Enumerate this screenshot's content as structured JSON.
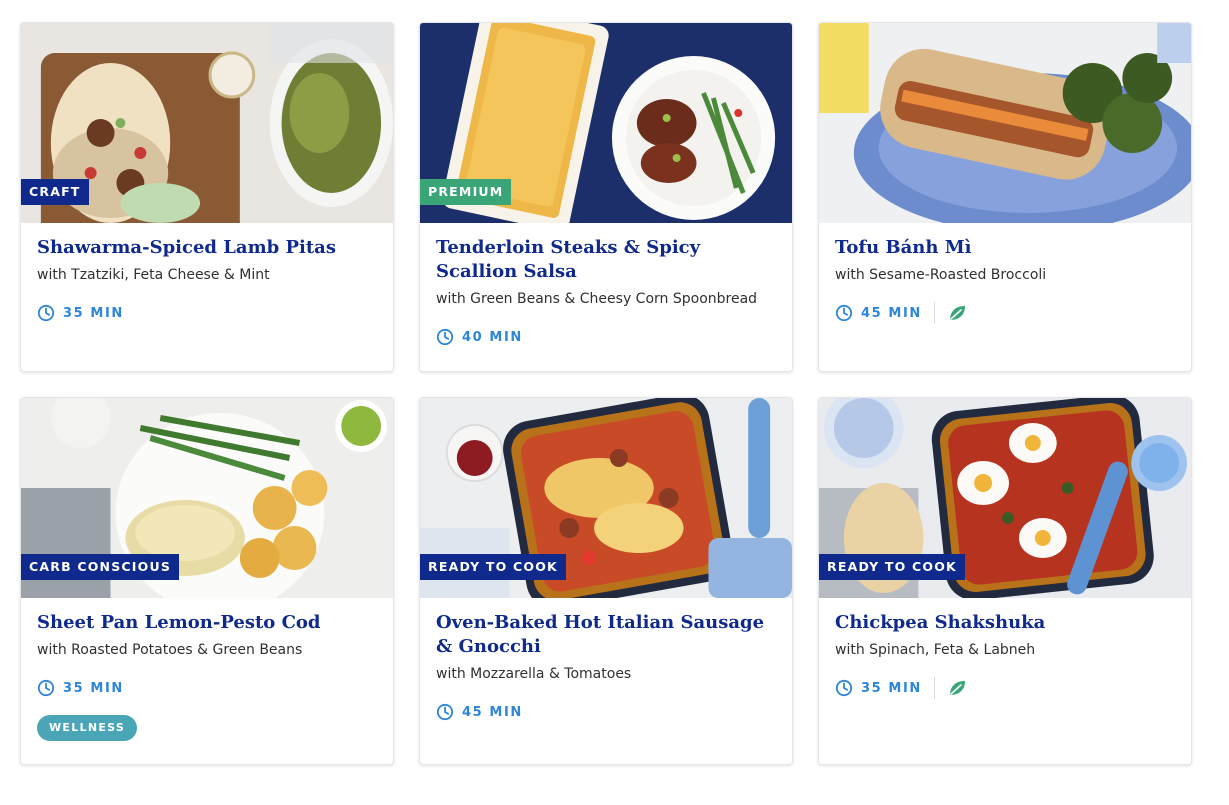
{
  "colors": {
    "title": "#0f2a8c",
    "time": "#2e86d9",
    "tag_navy": "#0f2a8c",
    "tag_green": "#3aa678",
    "pill_teal": "#4aa6b7",
    "leaf_green": "#3aa678"
  },
  "cards": [
    {
      "tag": "CRAFT",
      "title": "Shawarma-Spiced Lamb Pitas",
      "subtitle": "with Tzatziki, Feta Cheese & Mint",
      "time": "35 MIN",
      "image_icon": "lamb-pitas-photo"
    },
    {
      "tag": "PREMIUM",
      "title": "Tenderloin Steaks & Spicy Scallion Salsa",
      "subtitle": "with Green Beans & Cheesy Corn Spoonbread",
      "time": "40 MIN",
      "image_icon": "steak-photo"
    },
    {
      "tag": "",
      "title": "Tofu Bánh Mì",
      "subtitle": "with Sesame-Roasted Broccoli",
      "time": "45 MIN",
      "badge_icon": "leaf-icon",
      "image_icon": "banh-mi-photo"
    },
    {
      "tag": "CARB CONSCIOUS",
      "title": "Sheet Pan Lemon-Pesto Cod",
      "subtitle": "with Roasted Potatoes & Green Beans",
      "time": "35 MIN",
      "pill": "WELLNESS",
      "image_icon": "cod-photo"
    },
    {
      "tag": "READY TO COOK",
      "title": "Oven-Baked Hot Italian Sausage & Gnocchi",
      "subtitle": "with Mozzarella & Tomatoes",
      "time": "45 MIN",
      "image_icon": "gnocchi-photo"
    },
    {
      "tag": "READY TO COOK",
      "title": "Chickpea Shakshuka",
      "subtitle": "with Spinach, Feta & Labneh",
      "time": "35 MIN",
      "badge_icon": "leaf-icon",
      "image_icon": "shakshuka-photo"
    }
  ]
}
